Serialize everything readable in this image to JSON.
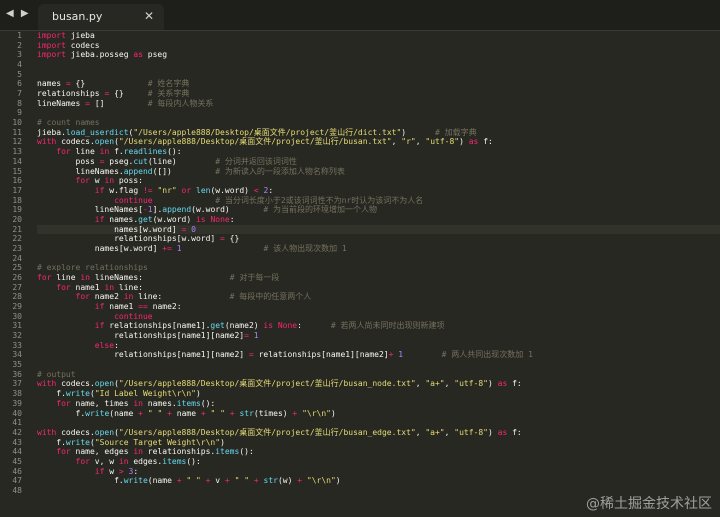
{
  "tabbar": {
    "nav_arrows": "◀ ▶",
    "active_tab": "busan.py",
    "close_glyph": "✕"
  },
  "editor": {
    "line_numbers": [
      "1",
      "2",
      "3",
      "4",
      "5",
      "6",
      "7",
      "8",
      "9",
      "10",
      "11",
      "12",
      "13",
      "14",
      "15",
      "16",
      "17",
      "18",
      "19",
      "20",
      "21",
      "22",
      "23",
      "24",
      "25",
      "26",
      "27",
      "28",
      "29",
      "30",
      "31",
      "32",
      "33",
      "34",
      "35",
      "36",
      "37",
      "38",
      "39",
      "40",
      "41",
      "42",
      "43",
      "44",
      "45",
      "46",
      "47",
      "48"
    ],
    "highlighted_line": 21,
    "lines": [
      "import jieba",
      "import codecs",
      "import jieba.posseg as pseg",
      "",
      "",
      "names = {}             # 姓名字典",
      "relationships = {}     # 关系字典",
      "lineNames = []         # 每段内人物关系",
      "",
      "# count names",
      "jieba.load_userdict(\"/Users/apple888/Desktop/桌面文件/project/釜山行/dict.txt\")      # 加载字典",
      "with codecs.open(\"/Users/apple888/Desktop/桌面文件/project/釜山行/busan.txt\", \"r\", \"utf-8\") as f:",
      "    for line in f.readlines():",
      "        poss = pseg.cut(line)        # 分词并返回该词词性",
      "        lineNames.append([])         # 为新读入的一段添加人物名称列表",
      "        for w in poss:",
      "            if w.flag != \"nr\" or len(w.word) < 2:",
      "                continue             # 当分词长度小于2或该词词性不为nr时认为该词不为人名",
      "            lineNames[-1].append(w.word)       # 为当前段的环境增加一个人物",
      "            if names.get(w.word) is None:",
      "                names[w.word] = 0",
      "                relationships[w.word] = {}",
      "            names[w.word] += 1                 # 该人物出现次数加 1",
      "",
      "# explore relationships",
      "for line in lineNames:                  # 对于每一段",
      "    for name1 in line:",
      "        for name2 in line:              # 每段中的任意两个人",
      "            if name1 == name2:",
      "                continue",
      "            if relationships[name1].get(name2) is None:      # 若两人尚未同时出现则新建项",
      "                relationships[name1][name2]= 1",
      "            else:",
      "                relationships[name1][name2] = relationships[name1][name2]+ 1        # 两人共同出现次数加 1",
      "",
      "# output",
      "with codecs.open(\"/Users/apple888/Desktop/桌面文件/project/釜山行/busan_node.txt\", \"a+\", \"utf-8\") as f:",
      "    f.write(\"Id Label Weight\\r\\n\")",
      "    for name, times in names.items():",
      "        f.write(name + \" \" + name + \" \" + str(times) + \"\\r\\n\")",
      "",
      "with codecs.open(\"/Users/apple888/Desktop/桌面文件/project/釜山行/busan_edge.txt\", \"a+\", \"utf-8\") as f:",
      "    f.write(\"Source Target Weight\\r\\n\")",
      "    for name, edges in relationships.items():",
      "        for v, w in edges.items():",
      "            if w > 3:",
      "                f.write(name + \" \" + v + \" \" + str(w) + \"\\r\\n\")",
      ""
    ]
  },
  "watermark": "@稀土掘金技术社区",
  "colors": {
    "background": "#272822",
    "keyword": "#f92672",
    "string": "#e6db74",
    "comment": "#75715e",
    "builtin": "#66d9ef",
    "number": "#ae81ff",
    "text": "#f8f8f2"
  }
}
